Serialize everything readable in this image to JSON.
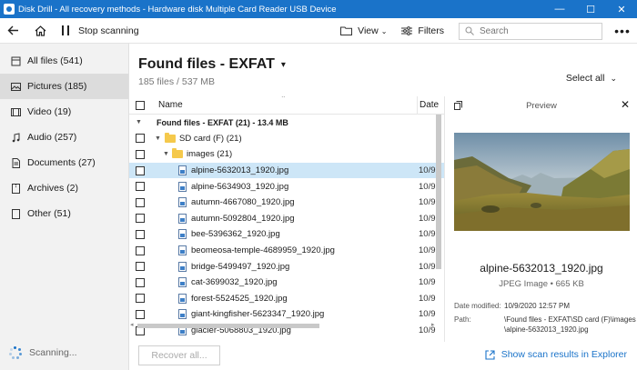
{
  "window": {
    "title": "Disk Drill - All recovery methods - Hardware disk Multiple Card  Reader USB Device",
    "minimize": "—",
    "maximize": "☐",
    "close": "✕",
    "title_bar_color": "#1a73c9"
  },
  "toolbar": {
    "back_icon": "arrow-left-icon",
    "home_icon": "home-icon",
    "stop_label": "Stop scanning",
    "view_label": "View",
    "filters_label": "Filters",
    "search_placeholder": "Search",
    "more_label": "•••"
  },
  "sidebar": {
    "items": [
      {
        "label": "All files (541)",
        "icon": "all-files-icon"
      },
      {
        "label": "Pictures (185)",
        "icon": "pictures-icon"
      },
      {
        "label": "Video (19)",
        "icon": "video-icon"
      },
      {
        "label": "Audio (257)",
        "icon": "audio-icon"
      },
      {
        "label": "Documents (27)",
        "icon": "documents-icon"
      },
      {
        "label": "Archives (2)",
        "icon": "archives-icon"
      },
      {
        "label": "Other (51)",
        "icon": "other-icon"
      }
    ],
    "active_index": 1,
    "scanning_label": "Scanning..."
  },
  "main": {
    "title": "Found files - EXFAT",
    "subtitle": "185 files / 537 MB",
    "select_all_label": "Select all",
    "columns": {
      "name": "Name",
      "date": "Date"
    },
    "rows": [
      {
        "type": "group",
        "label": "Found files - EXFAT (21) - 13.4 MB"
      },
      {
        "type": "folder",
        "label": "SD card (F) (21)"
      },
      {
        "type": "folder",
        "label": "images (21)"
      },
      {
        "type": "file",
        "label": "alpine-5632013_1920.jpg",
        "date": "10/9",
        "selected": true
      },
      {
        "type": "file",
        "label": "alpine-5634903_1920.jpg",
        "date": "10/9"
      },
      {
        "type": "file",
        "label": "autumn-4667080_1920.jpg",
        "date": "10/9"
      },
      {
        "type": "file",
        "label": "autumn-5092804_1920.jpg",
        "date": "10/9"
      },
      {
        "type": "file",
        "label": "bee-5396362_1920.jpg",
        "date": "10/9"
      },
      {
        "type": "file",
        "label": "beomeosa-temple-4689959_1920.jpg",
        "date": "10/9"
      },
      {
        "type": "file",
        "label": "bridge-5499497_1920.jpg",
        "date": "10/9"
      },
      {
        "type": "file",
        "label": "cat-3699032_1920.jpg",
        "date": "10/9"
      },
      {
        "type": "file",
        "label": "forest-5524525_1920.jpg",
        "date": "10/9"
      },
      {
        "type": "file",
        "label": "giant-kingfisher-5623347_1920.jpg",
        "date": "10/9"
      },
      {
        "type": "file",
        "label": "glacier-5068803_1920.jpg",
        "date": "10/9"
      }
    ],
    "recover_label": "Recover all...",
    "explorer_label": "Show scan results in Explorer"
  },
  "preview": {
    "title": "Preview",
    "file_name": "alpine-5632013_1920.jpg",
    "file_type": "JPEG Image • 665 KB",
    "date_modified_label": "Date modified:",
    "date_modified_value": "10/9/2020 12:57 PM",
    "path_label": "Path:",
    "path_value_line1": "\\Found files - EXFAT\\SD card (F)\\images",
    "path_value_line2": "\\alpine-5632013_1920.jpg"
  }
}
